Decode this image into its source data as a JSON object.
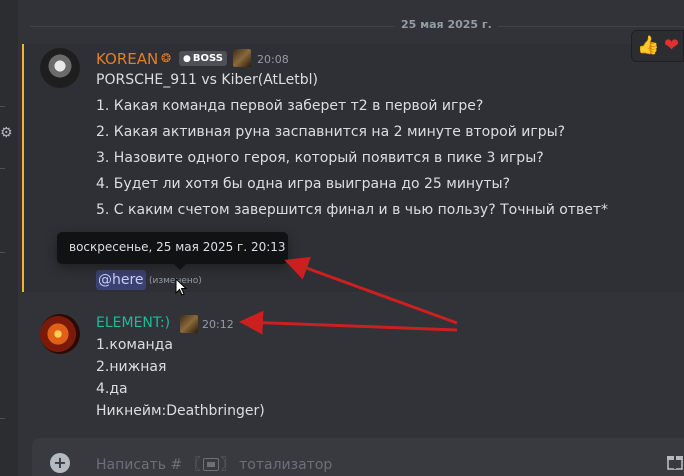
{
  "date_divider": "25 мая 2025 г.",
  "reactions": [
    {
      "emoji": "👍"
    },
    {
      "emoji": "❤"
    }
  ],
  "message1": {
    "author": "KOREAN",
    "author_color": "#e67e22",
    "badge": "BOSS",
    "time": "20:08",
    "lines": [
      "PORSCHE_911 vs Kiber(AtLetbl)",
      "1. Какая команда первой заберет т2 в первой игре?",
      "2. Какая активная руна заспавнится на 2 минуте второй игры?",
      "3. Назовите одного героя, который появится в пике 3 игры?",
      "4. Будет ли хотя бы одна игра выиграна до 25 минуты?",
      "5. С каким счетом завершится финал и в чью пользу? Точный ответ*"
    ],
    "mention": "@here",
    "edited": "(изменено)"
  },
  "tooltip": "воскресенье, 25 мая 2025 г. 20:13",
  "message2": {
    "author": "ELEMENT:)",
    "author_color": "#1abc9c",
    "time": "20:12",
    "lines": [
      "1.команда",
      "2.нижная",
      "4.да",
      "Никнейм:Deathbringer)"
    ]
  },
  "composer": {
    "placeholder_prefix": "Написать #",
    "placeholder_suffix": "тотализатор"
  },
  "colors": {
    "arrow": "#cc1f1f",
    "mention_bar": "#f0b232"
  }
}
